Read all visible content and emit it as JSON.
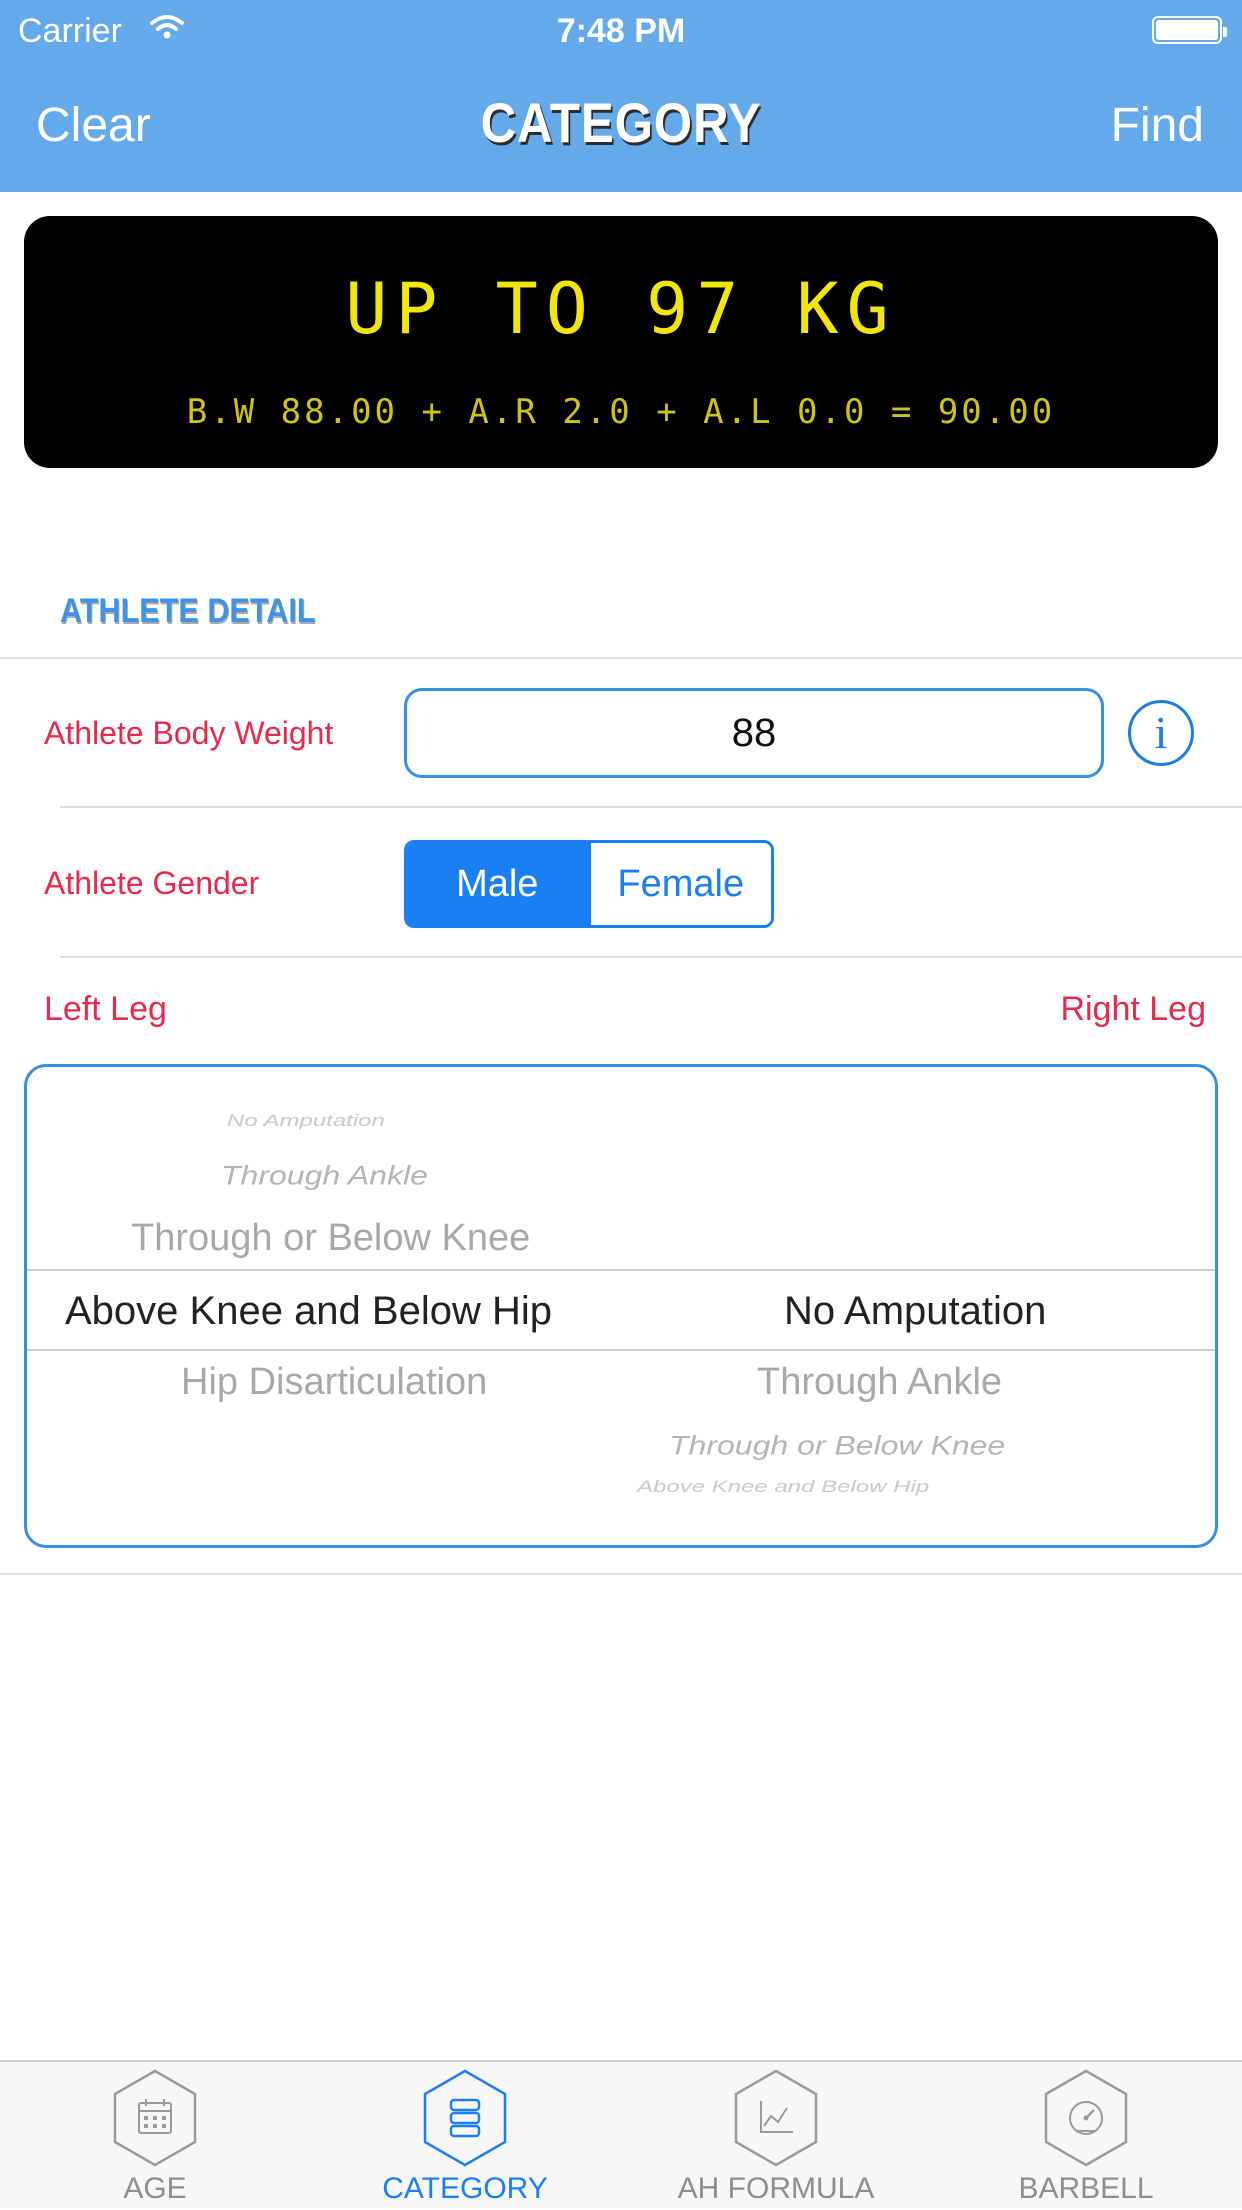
{
  "status_bar": {
    "carrier": "Carrier",
    "time": "7:48 PM"
  },
  "nav": {
    "left_button": "Clear",
    "title": "CATEGORY",
    "right_button": "Find"
  },
  "display": {
    "main": "UP TO 97 KG",
    "formula": "B.W 88.00 + A.R 2.0 + A.L 0.0 = 90.00",
    "text_color": "#f0e60b",
    "background": "#000000"
  },
  "section": {
    "title": "ATHLETE DETAIL"
  },
  "body_weight": {
    "label": "Athlete Body Weight",
    "value": "88"
  },
  "gender": {
    "label": "Athlete Gender",
    "options": [
      "Male",
      "Female"
    ],
    "selected": "Male"
  },
  "legs": {
    "left_label": "Left Leg",
    "right_label": "Right Leg",
    "left_column": [
      "No Amputation",
      "Through Ankle",
      "Through or Below Knee",
      "Above Knee and Below Hip",
      "Hip Disarticulation"
    ],
    "left_selected": "Above Knee and Below Hip",
    "right_column": [
      "No Amputation",
      "Through Ankle",
      "Through or Below Knee",
      "Above Knee and Below Hip"
    ],
    "right_selected": "No Amputation"
  },
  "tabs": [
    {
      "label": "AGE",
      "icon": "calendar-icon",
      "active": false
    },
    {
      "label": "CATEGORY",
      "icon": "database-icon",
      "active": true
    },
    {
      "label": "AH FORMULA",
      "icon": "chart-icon",
      "active": false
    },
    {
      "label": "BARBELL",
      "icon": "gauge-icon",
      "active": false
    }
  ],
  "colors": {
    "accent": "#1a7ff5",
    "nav_bar": "#64a9ea",
    "label_red": "#e8294c"
  }
}
